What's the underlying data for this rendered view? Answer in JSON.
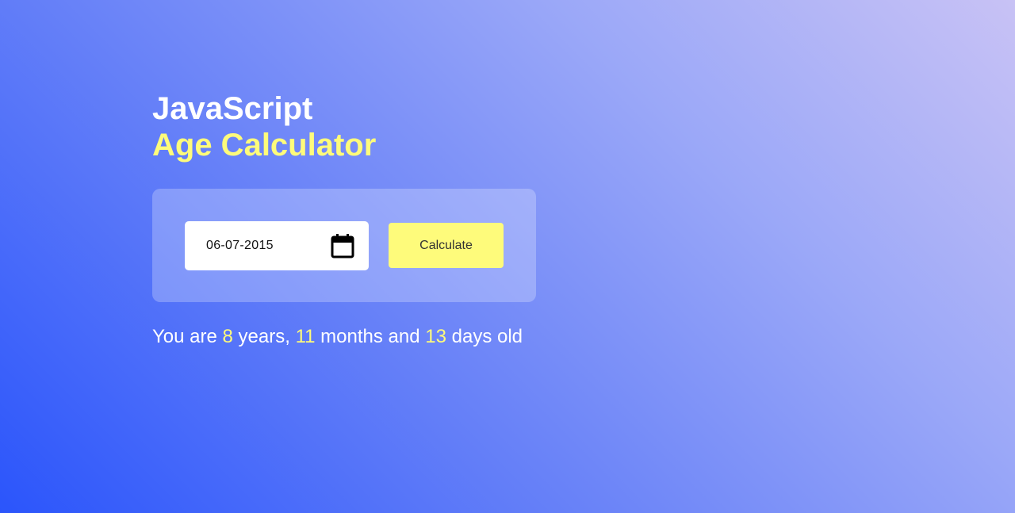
{
  "header": {
    "title_line1": "JavaScript",
    "title_line2": "Age Calculator"
  },
  "form": {
    "date_value": "06-07-2015",
    "calendar_icon": "calendar-icon",
    "calculate_label": "Calculate"
  },
  "result": {
    "prefix": "You are ",
    "years": "8",
    "years_label": " years, ",
    "months": "11",
    "months_label": " months and ",
    "days": "13",
    "days_label": " days old"
  },
  "colors": {
    "accent": "#fefb7b",
    "text": "#ffffff",
    "gradient_start": "#2b55fb",
    "gradient_end": "#c8c2f5"
  }
}
